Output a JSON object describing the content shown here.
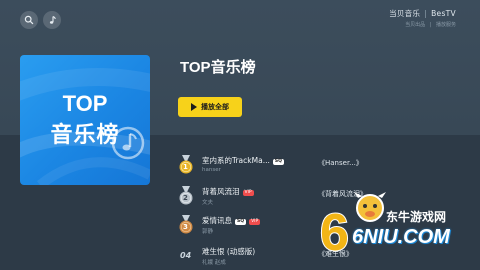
{
  "header": {
    "search_icon": "search-icon",
    "music_icon": "music-note-icon",
    "brand_left": "当贝音乐",
    "brand_right": "BesTV",
    "brand_sub_left": "当贝出品",
    "brand_sub_right": "播放服务"
  },
  "playlist": {
    "cover_line1": "TOP",
    "cover_line2": "音乐榜",
    "title": "TOP音乐榜",
    "play_all_label": "播放全部"
  },
  "songs": [
    {
      "rank": "1",
      "name": "室内系的TrackMa...",
      "tags": [
        "SQ"
      ],
      "artist": "hanser",
      "album": "《Hanser...》",
      "medal_color": "#e8b429"
    },
    {
      "rank": "2",
      "name": "背着风流泪",
      "tags": [
        "VIP"
      ],
      "artist": "文夫",
      "album": "《背着风流泪》",
      "medal_color": "#b9c2ca"
    },
    {
      "rank": "3",
      "name": "爱情讯息",
      "tags": [
        "SQ",
        "VIP"
      ],
      "artist": "郭静",
      "album": "",
      "medal_color": "#d08a45"
    },
    {
      "rank": "04",
      "name": "难生恨 (动感版)",
      "tags": [],
      "artist": "礼娥 赵成",
      "album": "《难生恨》",
      "medal_color": ""
    }
  ],
  "watermark": {
    "line1": "东牛游戏网",
    "line2": "6NIU.COM"
  },
  "colors": {
    "accent_yellow": "#f7d21a",
    "cover_blue": "#1b86e3",
    "background": "#2f3d4a"
  }
}
